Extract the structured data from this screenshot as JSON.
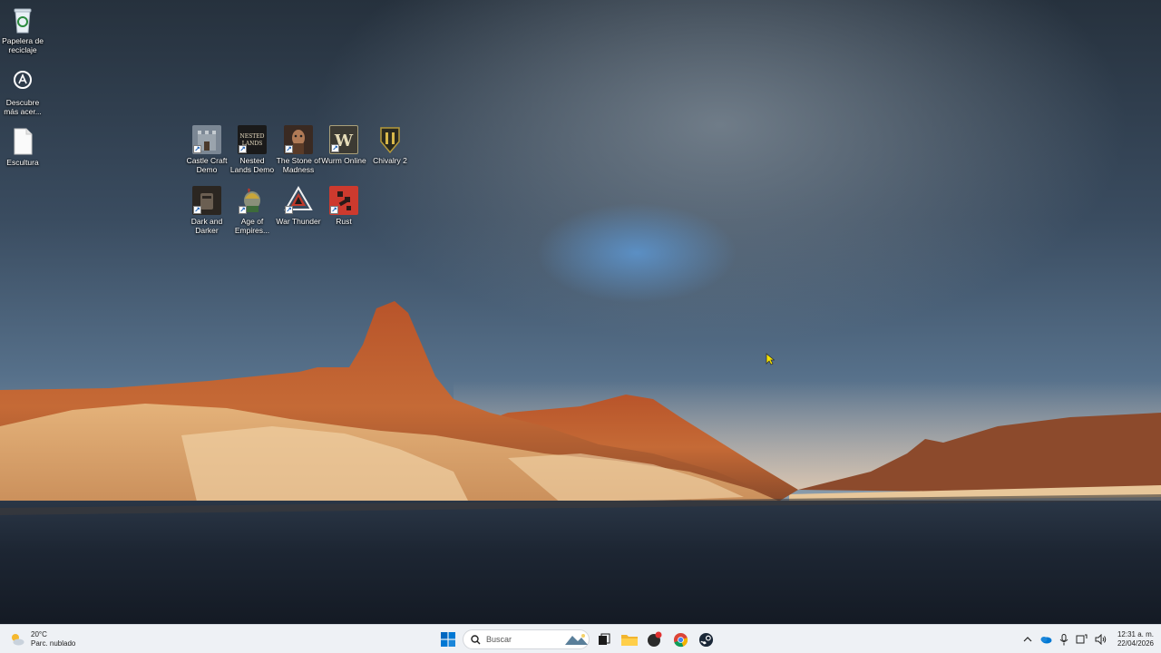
{
  "desktop": {
    "system_icons": [
      {
        "label": "Papelera de reciclaje",
        "icon": "recycle-bin-icon"
      },
      {
        "label": "Descubre más acer...",
        "icon": "acer-discover-icon"
      },
      {
        "label": "Escultura",
        "icon": "document-icon"
      }
    ],
    "shortcuts": [
      {
        "label": "Castle Craft Demo",
        "icon": "castle-craft-icon",
        "color": "#7b8794"
      },
      {
        "label": "Nested Lands Demo",
        "icon": "nested-lands-icon",
        "color": "#1a1a1a"
      },
      {
        "label": "The Stone of Madness",
        "icon": "stone-of-madness-icon",
        "color": "#3a2a22"
      },
      {
        "label": "Wurm Online",
        "icon": "wurm-online-icon",
        "color": "#3c3a33"
      },
      {
        "label": "Chivalry 2",
        "icon": "chivalry-2-icon",
        "color": "#2a2a20"
      },
      {
        "label": "Dark and Darker",
        "icon": "dark-and-darker-icon",
        "color": "#2b2621"
      },
      {
        "label": "Age of Empires...",
        "icon": "age-of-empires-icon",
        "color": "#6a7f4a"
      },
      {
        "label": "War Thunder",
        "icon": "war-thunder-icon",
        "color": "#c0392b"
      },
      {
        "label": "Rust",
        "icon": "rust-icon",
        "color": "#cd3a2e"
      }
    ]
  },
  "taskbar": {
    "weather_temp": "20°C",
    "weather_desc": "Parc. nublado",
    "search_placeholder": "Buscar",
    "time": "12:31 a. m.",
    "date": "22/04/2026",
    "accent": "#0067c0"
  }
}
